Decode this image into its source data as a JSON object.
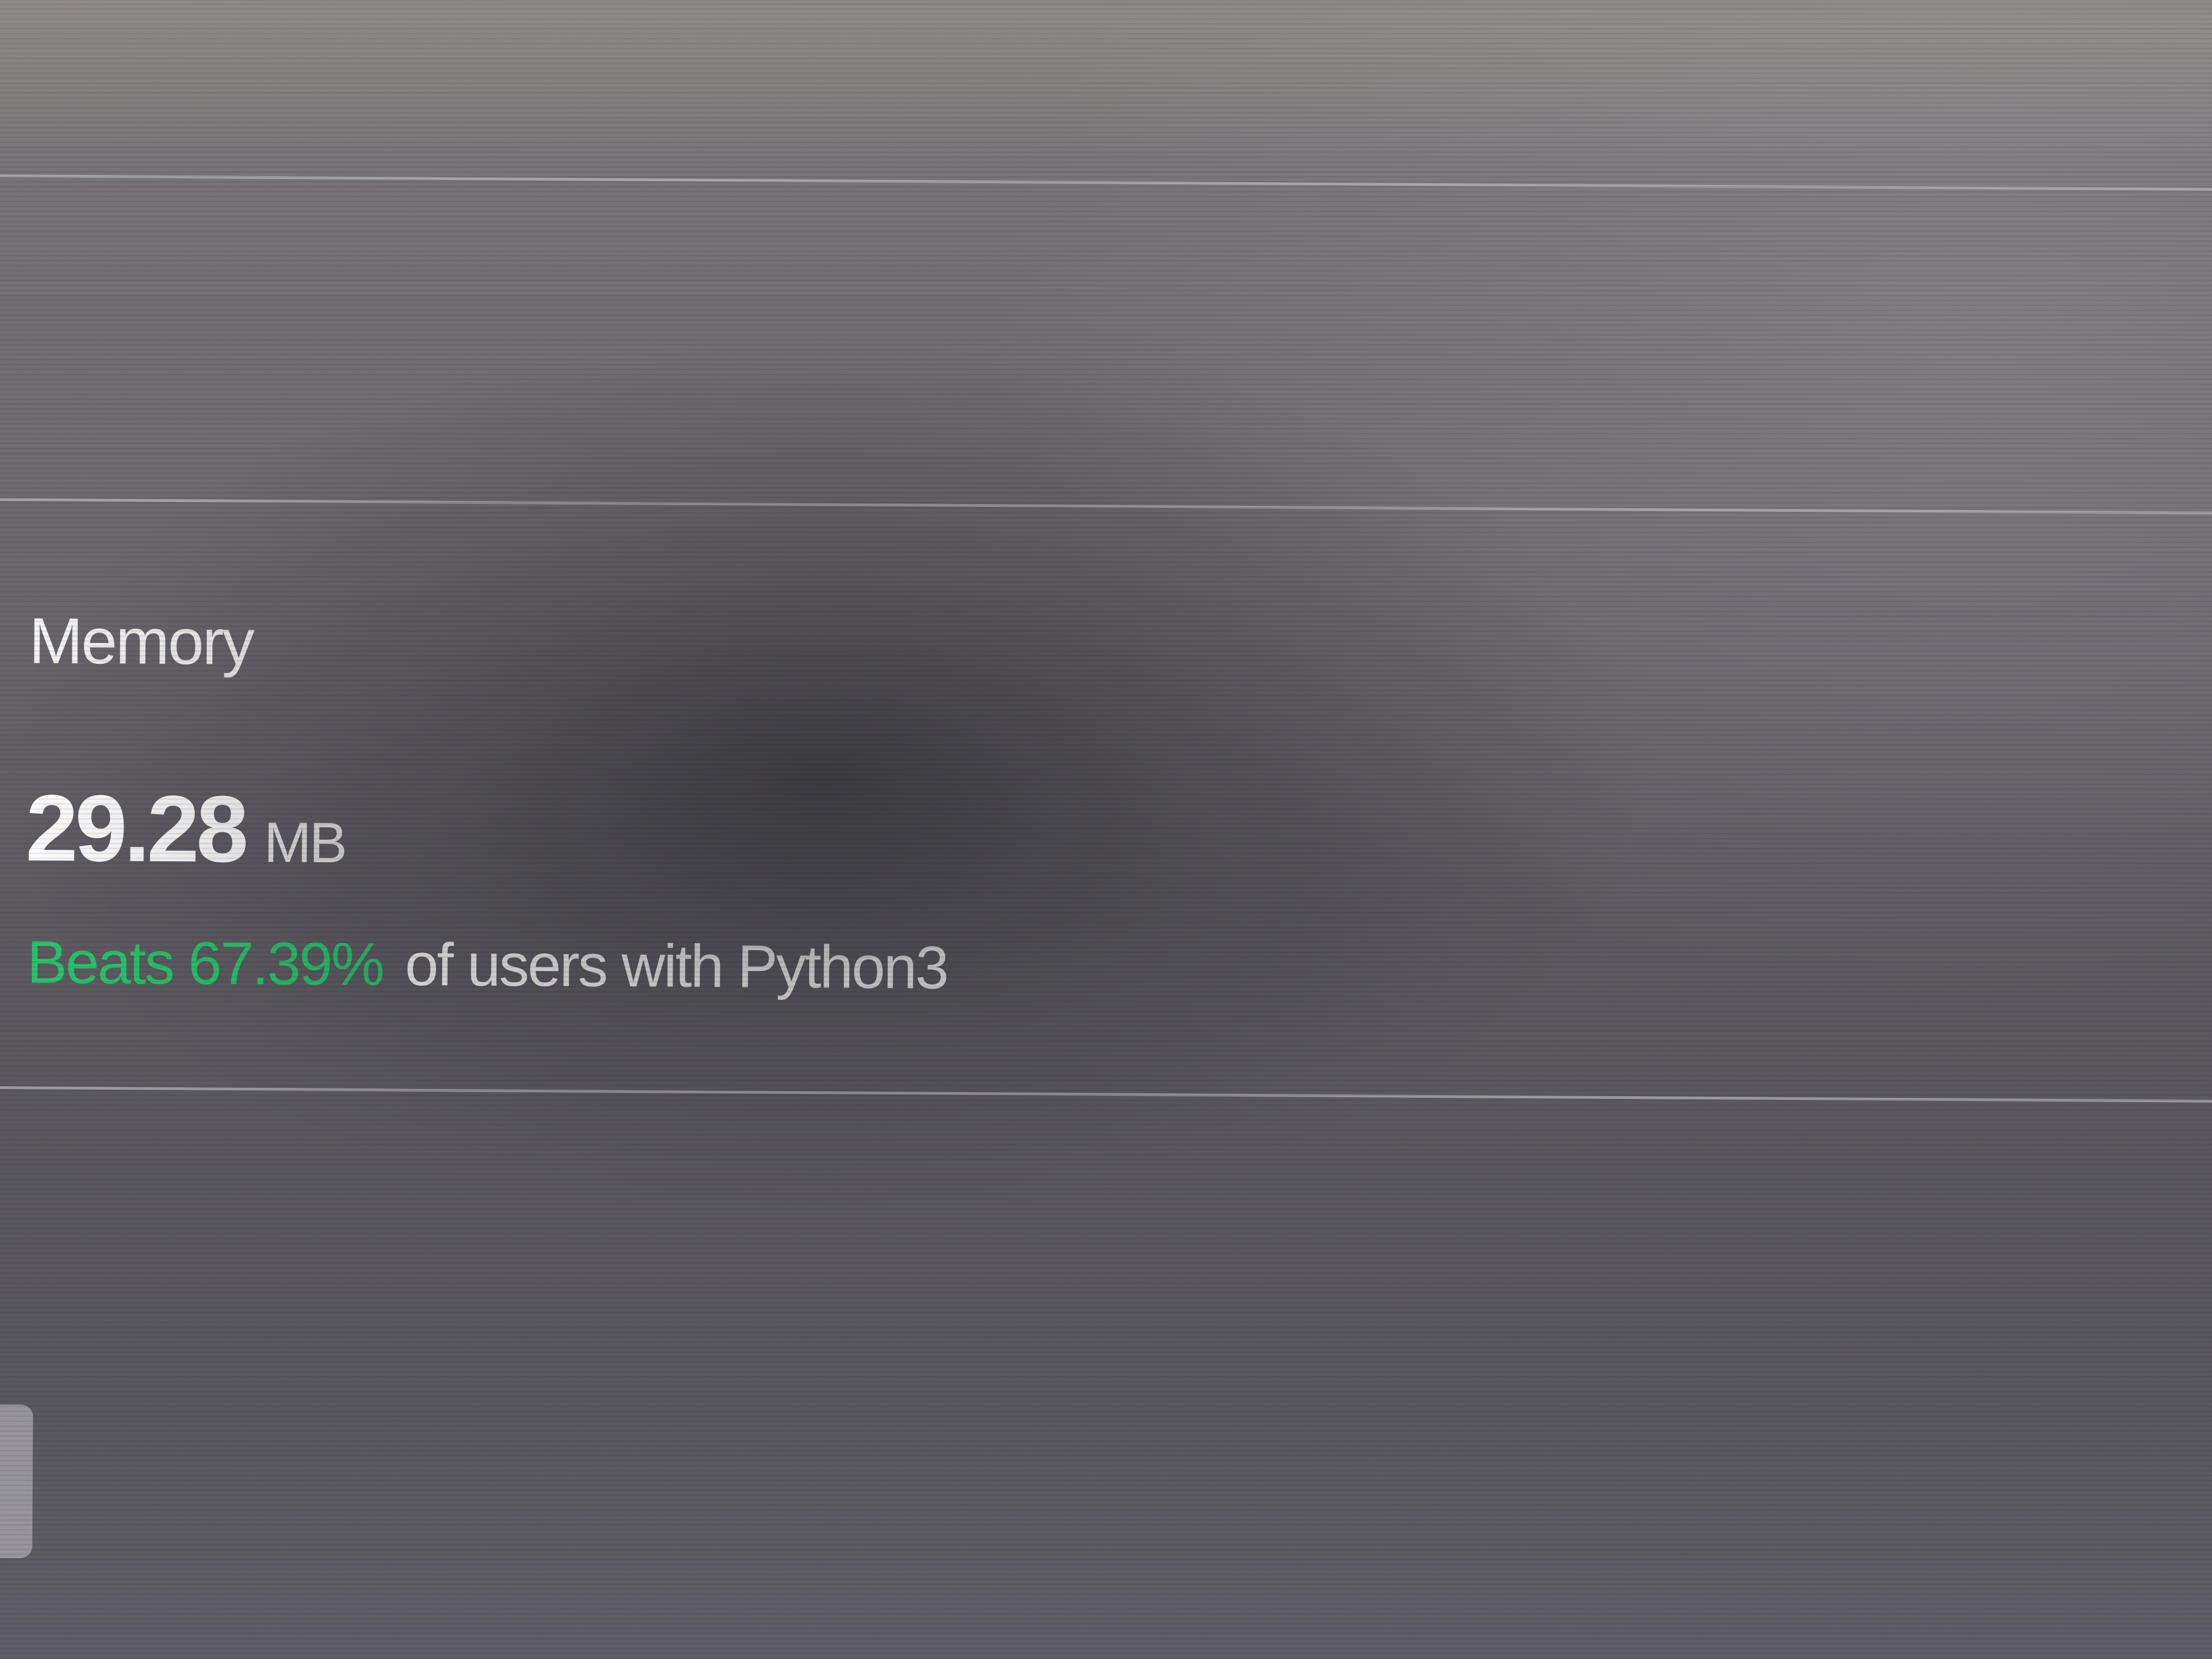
{
  "memory_card": {
    "title": "Memory",
    "value": "29.28",
    "unit": "MB",
    "beats_label": "Beats 67.39%",
    "beats_suffix": "of users with Python3",
    "beats_percent": 67.39
  },
  "colors": {
    "highlight_green": "#27c46a",
    "text_primary": "#ffffff"
  }
}
